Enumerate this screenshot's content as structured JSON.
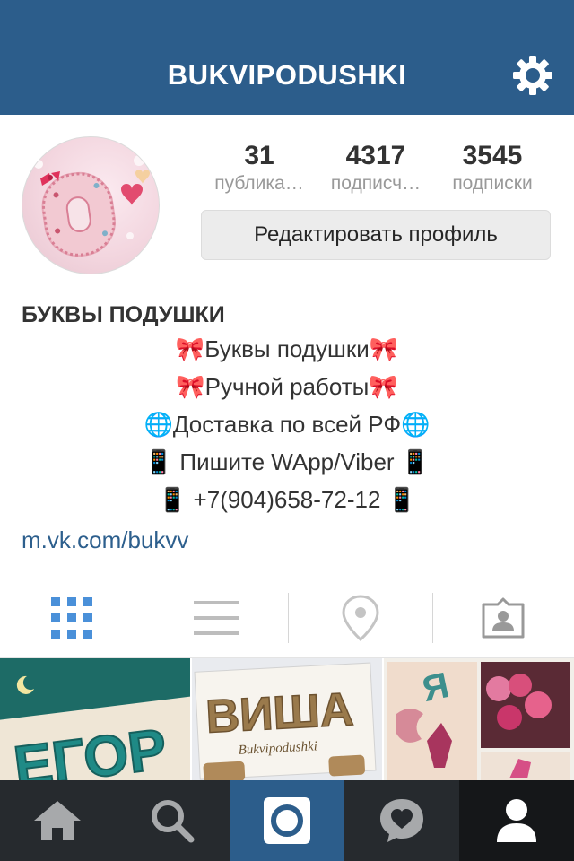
{
  "header": {
    "title": "BUKVIPODUSHKI",
    "bg_color": "#2c5d8b"
  },
  "profile": {
    "stats": [
      {
        "value": "31",
        "label": "публика…"
      },
      {
        "value": "4317",
        "label": "подписч…"
      },
      {
        "value": "3545",
        "label": "подписки"
      }
    ],
    "edit_button_label": "Редактировать профиль",
    "name": "БУКВЫ ПОДУШКИ",
    "bio_lines": [
      "🎀Буквы подушки🎀",
      "🎀Ручной работы🎀",
      "🌐Доставка по всей РФ🌐",
      "📱 Пишите WApp/Viber 📱",
      "📱 +7(904)658-72-12 📱"
    ],
    "link": "m.vk.com/bukvv",
    "link_color": "#2d5f8d"
  },
  "view_switcher": {
    "items": [
      "grid-icon",
      "list-icon",
      "location-pin-icon",
      "tagged-photos-icon"
    ],
    "active": "grid-icon",
    "active_color": "#4a90d9",
    "inactive_color": "#bdbdbd"
  },
  "photos": [
    {
      "caption_text": "ЕГОР"
    },
    {
      "caption_text": "ВИША",
      "watermark": "Bukvipodushki"
    },
    {
      "caption_text": "Я"
    }
  ],
  "tabbar": {
    "items": [
      "home-icon",
      "search-icon",
      "camera-icon",
      "activity-heart-icon",
      "profile-icon"
    ],
    "active": "profile-icon",
    "camera_color": "#2c5d8b"
  }
}
